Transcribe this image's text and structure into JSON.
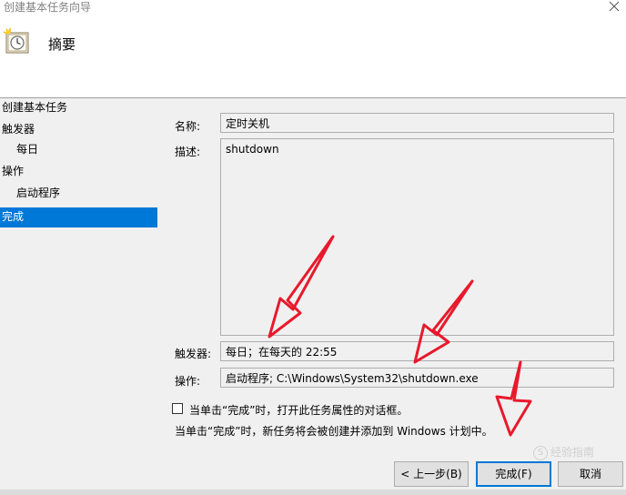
{
  "window": {
    "title": "创建基本任务向导"
  },
  "header": {
    "title": "摘要",
    "icon": "clock-task-icon"
  },
  "nav": {
    "items": [
      {
        "label": "创建基本任务",
        "level": 0,
        "active": false
      },
      {
        "label": "触发器",
        "level": 0,
        "active": false
      },
      {
        "label": "每日",
        "level": 1,
        "active": false
      },
      {
        "label": "操作",
        "level": 0,
        "active": false
      },
      {
        "label": "启动程序",
        "level": 1,
        "active": false
      },
      {
        "label": "完成",
        "level": 0,
        "active": true
      }
    ]
  },
  "form": {
    "name_label": "名称:",
    "name_value": "定时关机",
    "desc_label": "描述:",
    "desc_value": "shutdown",
    "trigger_label": "触发器:",
    "trigger_value": "每日；在每天的 22:55",
    "action_label": "操作:",
    "action_value": "启动程序; C:\\Windows\\System32\\shutdown.exe"
  },
  "options": {
    "open_props_label": "当单击“完成”时，打开此任务属性的对话框。",
    "open_props_checked": false,
    "note": "当单击“完成”时，新任务将会被创建并添加到 Windows 计划中。"
  },
  "buttons": {
    "back": "< 上一步(B)",
    "finish": "完成(F)",
    "cancel": "取消"
  },
  "watermark": {
    "text": "经验指南",
    "logo": "S"
  },
  "colors": {
    "accent": "#0078d7",
    "annotation_arrow": "#e8192c"
  }
}
